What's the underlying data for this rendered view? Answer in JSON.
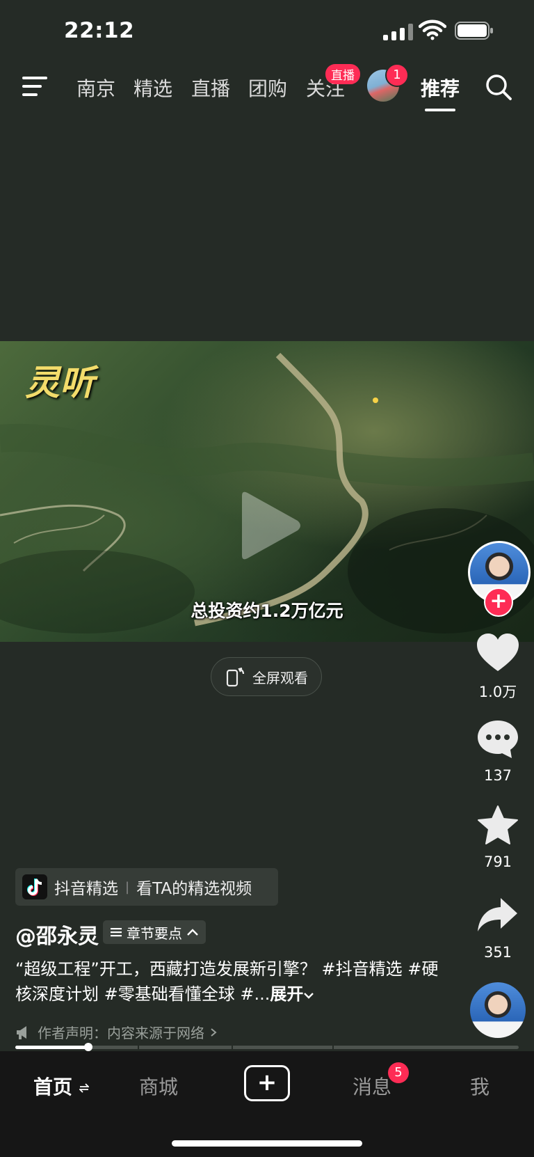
{
  "status_bar": {
    "time": "22:12"
  },
  "top_nav": {
    "tabs": [
      "南京",
      "精选",
      "直播",
      "团购",
      "关注"
    ],
    "live_badge": "直播",
    "avatar_badge_count": "1",
    "active_tab": "推荐"
  },
  "video": {
    "watermark": "灵听",
    "subtitle": "总投资约1.2万亿元",
    "fullscreen_label": "全屏观看"
  },
  "actions": {
    "likes": "1.0万",
    "comments": "137",
    "favorites": "791",
    "shares": "351"
  },
  "post": {
    "collection_name": "抖音精选",
    "collection_link": "看TA的精选视频",
    "author": "@邵永灵",
    "chapter_label": "章节要点",
    "description": "“超级工程”开工，西藏打造发展新引擎？ #抖音精选 #硬核深度计划 #零基础看懂全球 #...",
    "expand_label": "展开",
    "declaration": "作者声明：内容来源于网络"
  },
  "playback": {
    "progress": 0.145
  },
  "bottom_nav": {
    "home": "首页",
    "mall": "商城",
    "messages": "消息",
    "messages_badge": "5",
    "me": "我"
  },
  "colors": {
    "accent": "#fe2c55",
    "background": "#252b26",
    "tabbar": "#161616"
  }
}
